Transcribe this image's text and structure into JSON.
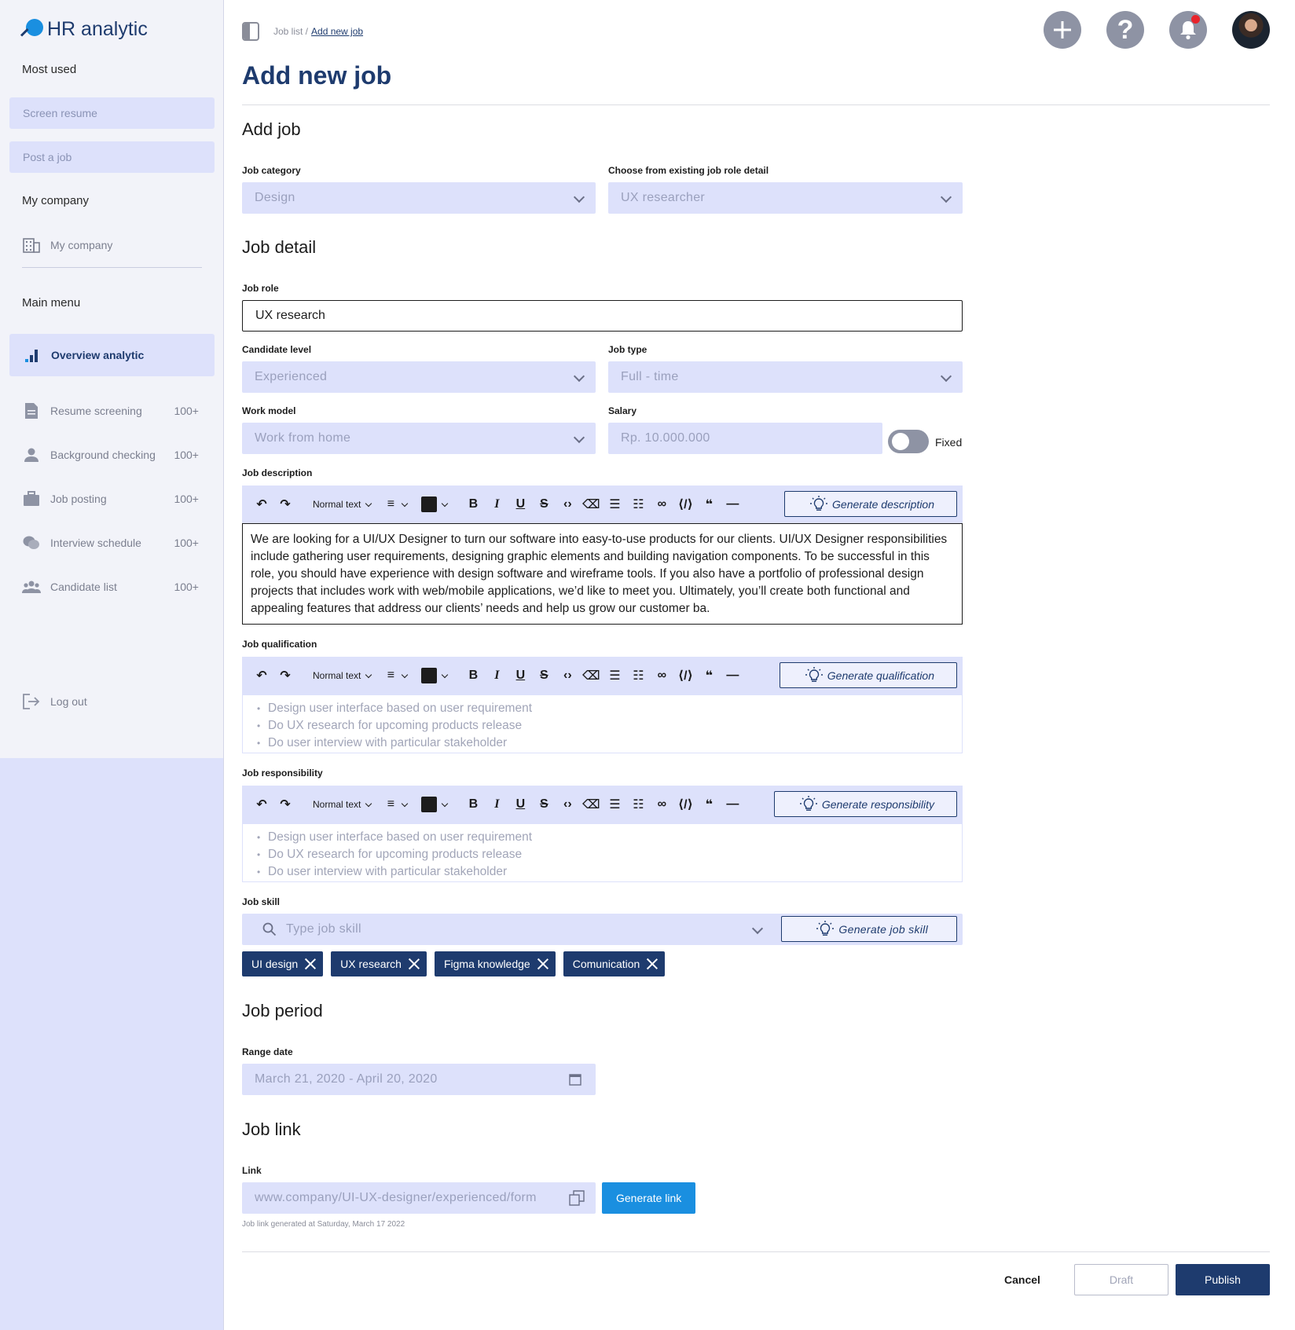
{
  "app": {
    "name": "HR analytic"
  },
  "sidebar": {
    "most_used_label": "Most used",
    "most_used": [
      "Screen resume",
      "Post a job"
    ],
    "company_label": "My company",
    "company_item": "My company",
    "main_menu_label": "Main menu",
    "active_item": "Overview analytic",
    "items": [
      {
        "label": "Resume screening",
        "count": "100+",
        "icon": "document-icon"
      },
      {
        "label": "Background checking",
        "count": "100+",
        "icon": "person-icon"
      },
      {
        "label": "Job posting",
        "count": "100+",
        "icon": "briefcase-icon"
      },
      {
        "label": "Interview schedule",
        "count": "100+",
        "icon": "chat-icon"
      },
      {
        "label": "Candidate list",
        "count": "100+",
        "icon": "group-icon"
      }
    ],
    "logout": "Log out"
  },
  "header": {
    "breadcrumb_parent": "Job list /",
    "breadcrumb_current": "Add new job",
    "title": "Add new job"
  },
  "add_job": {
    "heading": "Add job",
    "category_label": "Job category",
    "category_value": "Design",
    "existing_label": "Choose from existing job role detail",
    "existing_value": "UX researcher"
  },
  "job_detail": {
    "heading": "Job detail",
    "role_label": "Job role",
    "role_value": "UX research",
    "level_label": "Candidate level",
    "level_value": "Experienced",
    "type_label": "Job type",
    "type_value": "Full - time",
    "model_label": "Work model",
    "model_value": "Work from home",
    "salary_label": "Salary",
    "salary_placeholder": "Rp. 10.000.000",
    "fixed_label": "Fixed",
    "description_label": "Job description",
    "description_text": "We are looking for a UI/UX Designer to turn our software into easy-to-use products for our clients. UI/UX Designer responsibilities include gathering user requirements, designing graphic elements and building navigation components. To be successful in this role, you should have experience with design software and wireframe tools. If you also have a portfolio of professional design projects that includes work with web/mobile applications, we’d like to meet you. Ultimately, you’ll create both functional and appealing features that address our clients’ needs and help us grow our customer ba.",
    "generate_description": "Generate description",
    "qualification_label": "Job qualification",
    "generate_qualification": "Generate qualification",
    "qualification_items": [
      "Design user interface based on user requirement",
      "Do UX research for upcoming products release",
      "Do user interview with particular stakeholder"
    ],
    "responsibility_label": "Job responsibility",
    "generate_responsibility": "Generate responsibility",
    "responsibility_items": [
      "Design user interface based on user requirement",
      "Do UX research for upcoming products release",
      "Do user interview with particular stakeholder"
    ],
    "toolbar_normal_text": "Normal text",
    "skill_label": "Job skill",
    "skill_placeholder": "Type job skill",
    "generate_skill": "Generate job skill",
    "skills": [
      "UI design",
      "UX research",
      "Figma knowledge",
      "Comunication"
    ]
  },
  "job_period": {
    "heading": "Job period",
    "range_label": "Range date",
    "range_value": "March 21, 2020 - April 20, 2020"
  },
  "job_link": {
    "heading": "Job link",
    "link_label": "Link",
    "link_value": "www.company/UI-UX-designer/experienced/form",
    "generate_link": "Generate link",
    "note": "Job link generated at Saturday, March 17 2022"
  },
  "footer": {
    "cancel": "Cancel",
    "draft": "Draft",
    "publish": "Publish"
  },
  "colors": {
    "primary": "#1e3b6e",
    "accent": "#1a8fe0",
    "field_bg": "#dde1fb",
    "sidebar_bg": "#f2f3f9",
    "alert": "#e8242b"
  }
}
